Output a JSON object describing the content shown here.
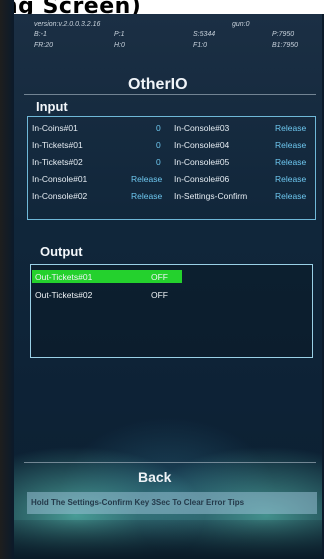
{
  "top_caption": "ng Screen)",
  "header": {
    "version": "version:v.2.0.0.3.2.16",
    "gun": "gun:0",
    "b": "B:-1",
    "p1": "P:1",
    "s": "S:5344",
    "p": "P:7950",
    "fr": "FR:20",
    "h": "H:0",
    "f": "F1:0",
    "b1": "B1:7950"
  },
  "title": "OtherIO",
  "input": {
    "label": "Input",
    "left": [
      {
        "name": "In-Coins#01",
        "value": "0"
      },
      {
        "name": "In-Tickets#01",
        "value": "0"
      },
      {
        "name": "In-Tickets#02",
        "value": "0"
      },
      {
        "name": "In-Console#01",
        "value": "Release"
      },
      {
        "name": "In-Console#02",
        "value": "Release"
      }
    ],
    "right": [
      {
        "name": "In-Console#03",
        "value": "Release"
      },
      {
        "name": "In-Console#04",
        "value": "Release"
      },
      {
        "name": "In-Console#05",
        "value": "Release"
      },
      {
        "name": "In-Console#06",
        "value": "Release"
      },
      {
        "name": "In-Settings-Confirm",
        "value": "Release"
      }
    ]
  },
  "output": {
    "label": "Output",
    "rows": [
      {
        "name": "Out-Tickets#01",
        "value": "OFF",
        "selected": true
      },
      {
        "name": "Out-Tickets#02",
        "value": "OFF",
        "selected": false
      }
    ]
  },
  "back_label": "Back",
  "tip": "Hold The Settings-Confirm Key 3Sec To Clear Error Tips",
  "colors": {
    "accent": "#6ec8f0",
    "selected": "#24d12d",
    "background": "#10263a"
  }
}
